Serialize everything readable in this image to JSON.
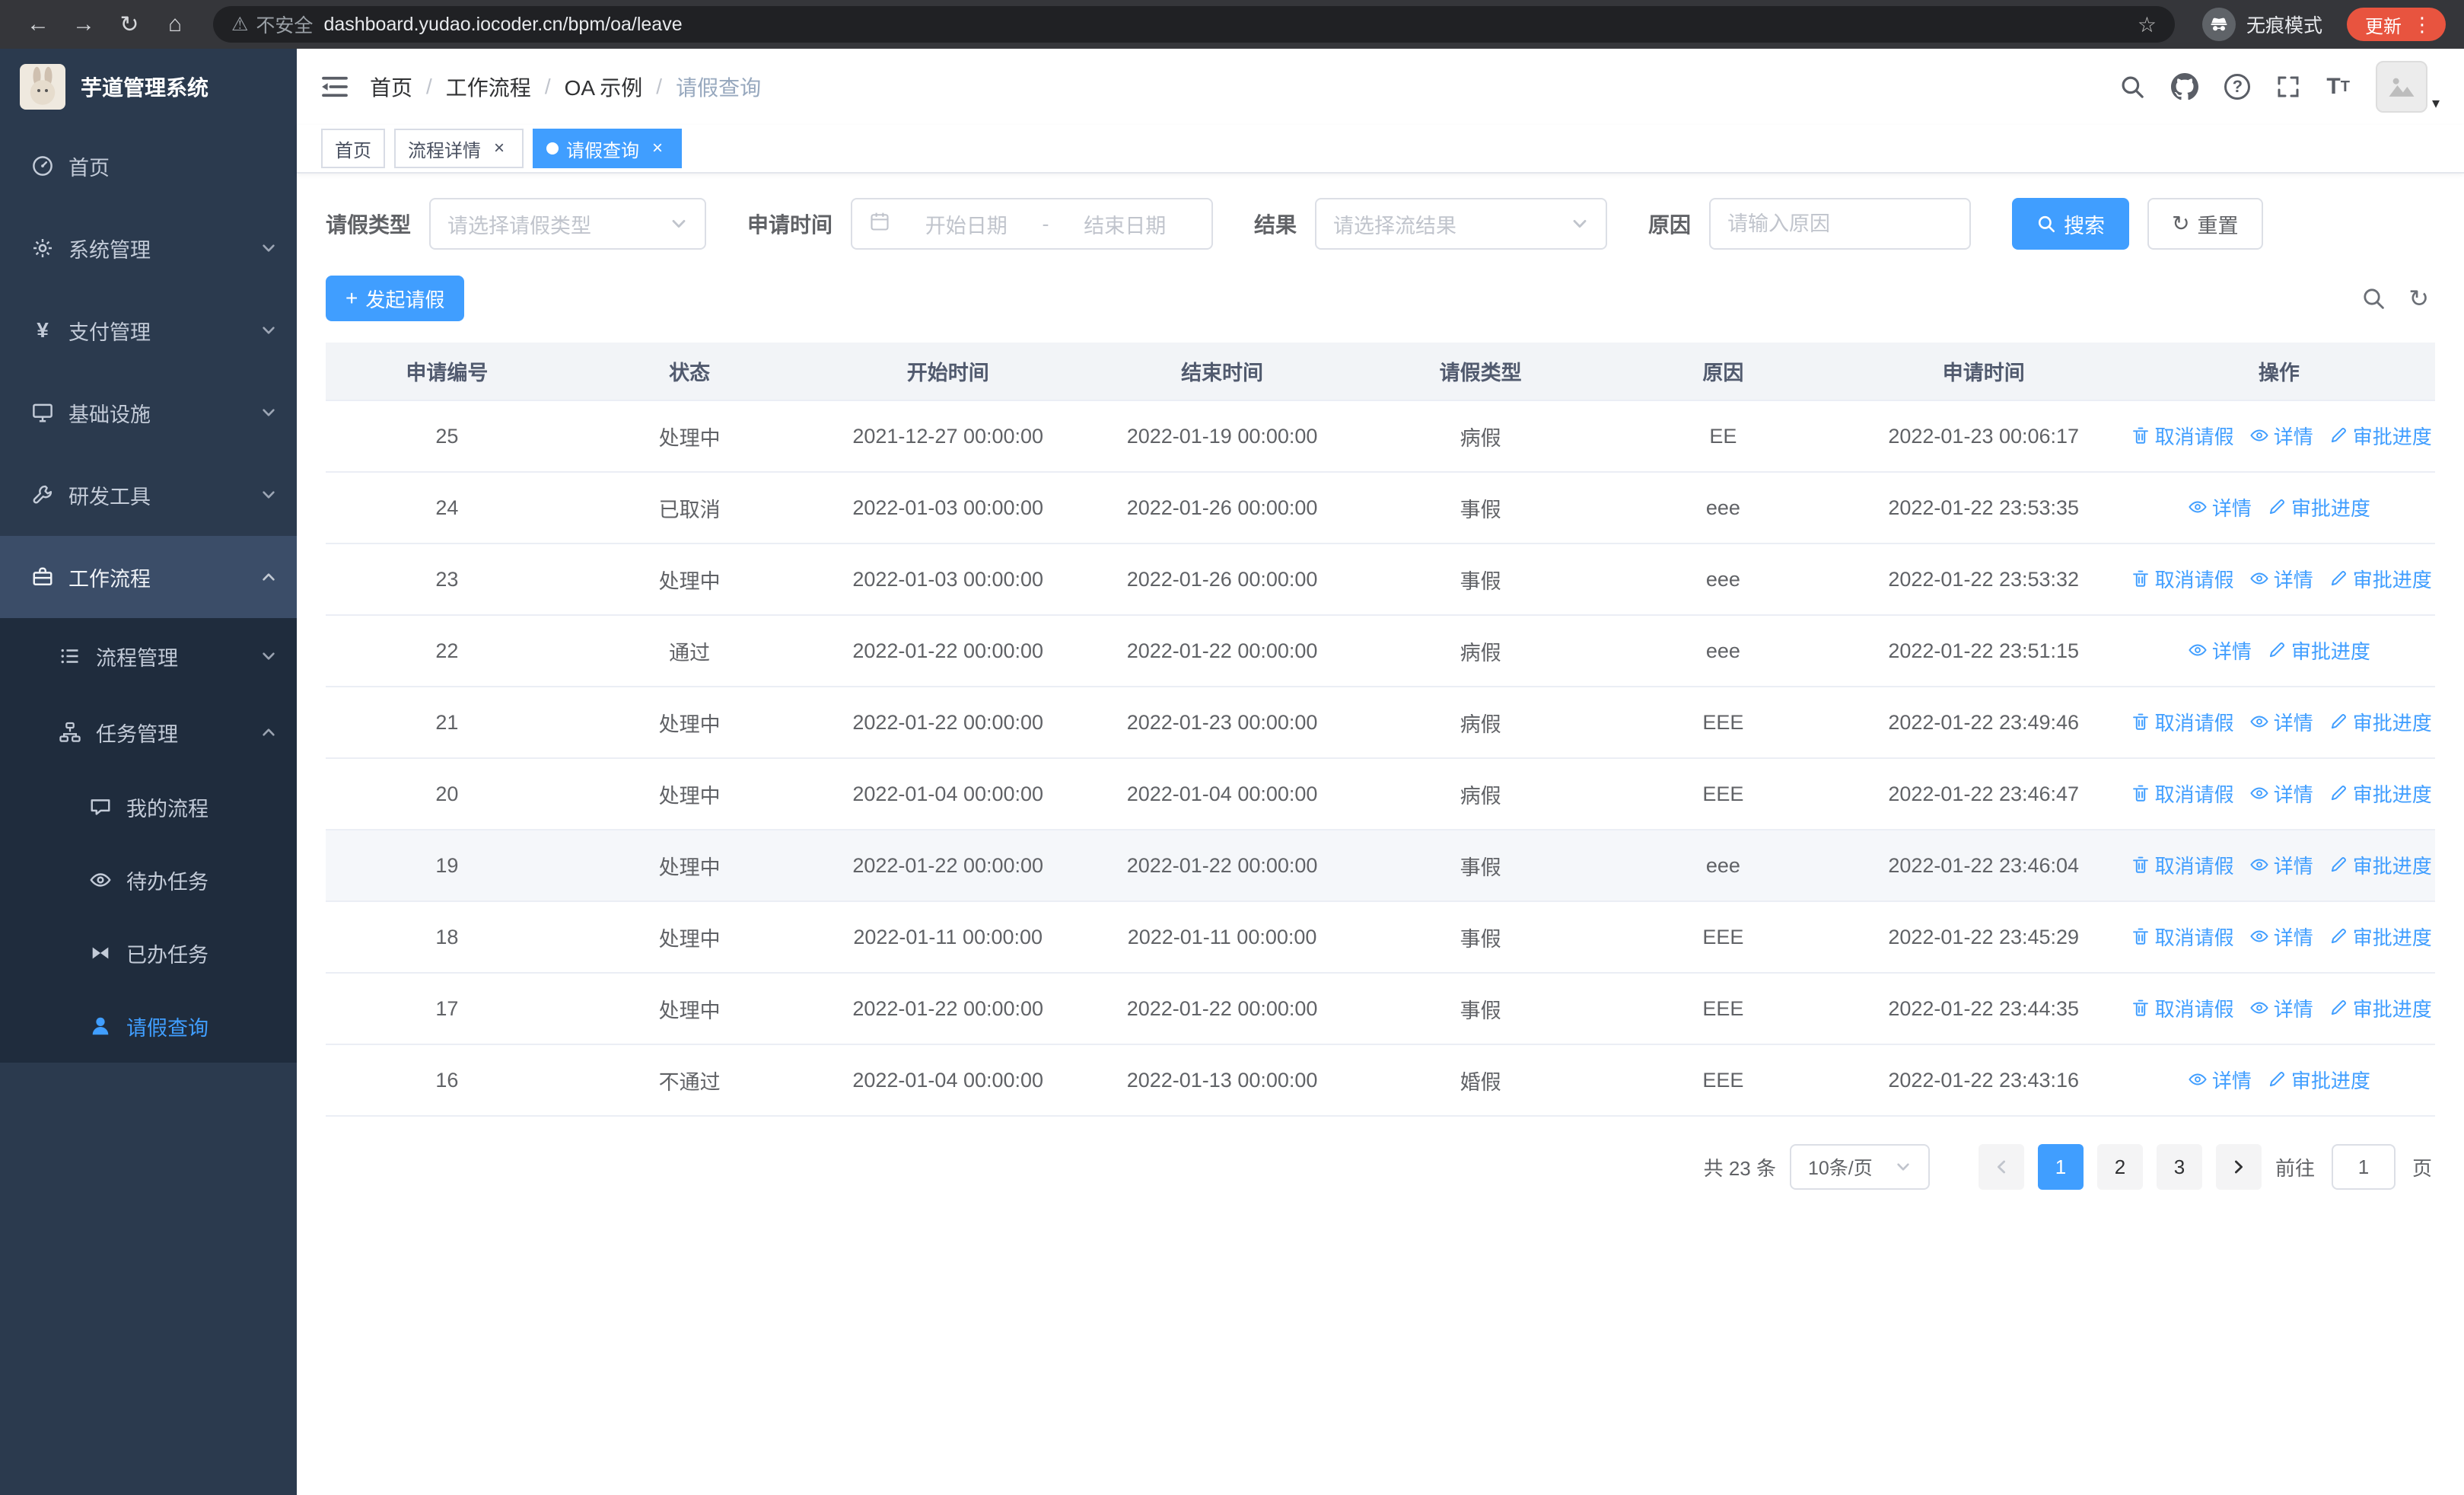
{
  "icons": {
    "back": "←",
    "forward": "→",
    "reload": "↻",
    "home": "⌂",
    "warning": "⚠",
    "star": "☆",
    "kebab": "⋮",
    "close": "×",
    "plus": "+",
    "refresh": "↻",
    "question": "?",
    "yen": "¥",
    "letter": "T",
    "caret": "▾"
  },
  "browser": {
    "security_label": "不安全",
    "url": "dashboard.yudao.iocoder.cn/bpm/oa/leave",
    "incognito_label": "无痕模式",
    "update_label": "更新"
  },
  "sidebar": {
    "title": "芋道管理系统",
    "items": [
      {
        "label": "首页"
      },
      {
        "label": "系统管理"
      },
      {
        "label": "支付管理"
      },
      {
        "label": "基础设施"
      },
      {
        "label": "研发工具"
      },
      {
        "label": "工作流程"
      },
      {
        "label": "流程管理"
      },
      {
        "label": "任务管理"
      },
      {
        "label": "我的流程"
      },
      {
        "label": "待办任务"
      },
      {
        "label": "已办任务"
      },
      {
        "label": "请假查询"
      }
    ]
  },
  "header": {
    "separator": "/",
    "breadcrumb": [
      {
        "label": "首页"
      },
      {
        "label": "工作流程"
      },
      {
        "label": "OA 示例"
      },
      {
        "label": "请假查询"
      }
    ]
  },
  "tabs": [
    {
      "label": "首页"
    },
    {
      "label": "流程详情"
    },
    {
      "label": "请假查询"
    }
  ],
  "filters": {
    "leave_type_label": "请假类型",
    "leave_type_placeholder": "请选择请假类型",
    "apply_time_label": "申请时间",
    "date_start_placeholder": "开始日期",
    "date_separator": "-",
    "date_end_placeholder": "结束日期",
    "result_label": "结果",
    "result_placeholder": "请选择流结果",
    "reason_label": "原因",
    "reason_placeholder": "请输入原因",
    "search_label": "搜索",
    "reset_label": "重置"
  },
  "toolbar": {
    "create_label": "发起请假"
  },
  "table": {
    "columns": [
      "申请编号",
      "状态",
      "开始时间",
      "结束时间",
      "请假类型",
      "原因",
      "申请时间",
      "操作"
    ],
    "action_labels": {
      "cancel": "取消请假",
      "detail": "详情",
      "progress": "审批进度"
    },
    "rows": [
      {
        "id": "25",
        "status": "处理中",
        "start": "2021-12-27 00:00:00",
        "end": "2022-01-19 00:00:00",
        "type": "病假",
        "reason": "EE",
        "applied": "2022-01-23 00:06:17",
        "cancellable": true
      },
      {
        "id": "24",
        "status": "已取消",
        "start": "2022-01-03 00:00:00",
        "end": "2022-01-26 00:00:00",
        "type": "事假",
        "reason": "eee",
        "applied": "2022-01-22 23:53:35",
        "cancellable": false
      },
      {
        "id": "23",
        "status": "处理中",
        "start": "2022-01-03 00:00:00",
        "end": "2022-01-26 00:00:00",
        "type": "事假",
        "reason": "eee",
        "applied": "2022-01-22 23:53:32",
        "cancellable": true
      },
      {
        "id": "22",
        "status": "通过",
        "start": "2022-01-22 00:00:00",
        "end": "2022-01-22 00:00:00",
        "type": "病假",
        "reason": "eee",
        "applied": "2022-01-22 23:51:15",
        "cancellable": false
      },
      {
        "id": "21",
        "status": "处理中",
        "start": "2022-01-22 00:00:00",
        "end": "2022-01-23 00:00:00",
        "type": "病假",
        "reason": "EEE",
        "applied": "2022-01-22 23:49:46",
        "cancellable": true
      },
      {
        "id": "20",
        "status": "处理中",
        "start": "2022-01-04 00:00:00",
        "end": "2022-01-04 00:00:00",
        "type": "病假",
        "reason": "EEE",
        "applied": "2022-01-22 23:46:47",
        "cancellable": true
      },
      {
        "id": "19",
        "status": "处理中",
        "start": "2022-01-22 00:00:00",
        "end": "2022-01-22 00:00:00",
        "type": "事假",
        "reason": "eee",
        "applied": "2022-01-22 23:46:04",
        "cancellable": true
      },
      {
        "id": "18",
        "status": "处理中",
        "start": "2022-01-11 00:00:00",
        "end": "2022-01-11 00:00:00",
        "type": "事假",
        "reason": "EEE",
        "applied": "2022-01-22 23:45:29",
        "cancellable": true
      },
      {
        "id": "17",
        "status": "处理中",
        "start": "2022-01-22 00:00:00",
        "end": "2022-01-22 00:00:00",
        "type": "事假",
        "reason": "EEE",
        "applied": "2022-01-22 23:44:35",
        "cancellable": true
      },
      {
        "id": "16",
        "status": "不通过",
        "start": "2022-01-04 00:00:00",
        "end": "2022-01-13 00:00:00",
        "type": "婚假",
        "reason": "EEE",
        "applied": "2022-01-22 23:43:16",
        "cancellable": false
      }
    ]
  },
  "pagination": {
    "total_label": "共 23 条",
    "page_size": "10条/页",
    "pages": [
      "1",
      "2",
      "3"
    ],
    "goto_label": "前往",
    "goto_value": "1",
    "goto_suffix": "页"
  }
}
